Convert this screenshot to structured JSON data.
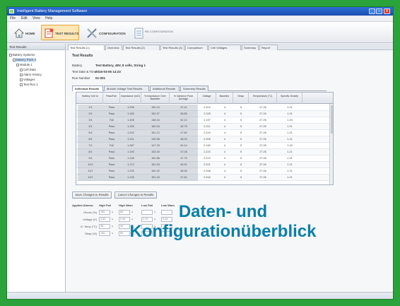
{
  "window": {
    "title": "Intelligent Battery Management Software",
    "controls": {
      "minimize": "_",
      "maximize": "□",
      "close": "X"
    }
  },
  "menu": [
    "File",
    "Edit",
    "View",
    "Help"
  ],
  "ribbon": {
    "home_label": "HOME",
    "test_results_label": "TEST RESULTS",
    "configuration_label": "CONFIGURATION",
    "reconfiguration_label": "RE-CONFIGURATION"
  },
  "sidebar": {
    "header": "Test Results",
    "tree": [
      "Battery Systems",
      "Battery Pack A",
      "Module 1",
      "Cell Data",
      "Alarm History",
      "Voltages",
      "Test Run 1"
    ]
  },
  "tabs": [
    "Test Results (1)",
    "Overview",
    "Test Results (2)",
    "Test Results (3)",
    "Comparison",
    "Cell Voltages",
    "Summary",
    "Report"
  ],
  "section": {
    "title": "Test Results",
    "rows": [
      {
        "label": "Battery",
        "value": "Test Battery, 48V, 8 cells, String 1"
      },
      {
        "label": "Test Date & Time",
        "value": "2015-03-05 14:23"
      },
      {
        "label": "Run Number",
        "value": "01-001"
      }
    ]
  },
  "subtabs": [
    "Individual Results",
    "Module Voltage Test Results",
    "Additional Results",
    "Summary Results"
  ],
  "table": {
    "headers": [
      "Battery Cell Id",
      "Pass/Fail",
      "Impedance (mΩ)",
      "% Impedance Over Baseline",
      "% Variance From Average",
      "Voltage",
      "Baseline",
      "Strap",
      "Temperature (°C)",
      "Specific Gravity"
    ],
    "rows": [
      [
        "1/1",
        "Pass",
        "1.296",
        "150.10",
        "47.41",
        "2.204",
        "4",
        "5",
        "27.26",
        "1.21"
      ],
      [
        "2/1",
        "Pass",
        "1.183",
        "152.37",
        "36.85",
        "2.228",
        "4",
        "5",
        "27.26",
        "1.21"
      ],
      [
        "3/1",
        "Fail",
        "1.406",
        "148.16",
        "52.10",
        "2.197",
        "4",
        "5",
        "27.26",
        "1.20"
      ],
      [
        "4/1",
        "Pass",
        "1.163",
        "150.04",
        "46.79",
        "2.211",
        "4",
        "5",
        "27.26",
        "1.21"
      ],
      [
        "5/1",
        "Pass",
        "1.202",
        "151.12",
        "47.82",
        "2.219",
        "4",
        "5",
        "27.26",
        "1.21"
      ],
      [
        "6/1",
        "Pass",
        "1.211",
        "149.58",
        "48.03",
        "2.206",
        "4",
        "5",
        "27.26",
        "1.21"
      ],
      [
        "7/1",
        "Fail",
        "1.387",
        "147.25",
        "50.14",
        "2.190",
        "4",
        "5",
        "27.26",
        "1.20"
      ],
      [
        "8/1",
        "Pass",
        "1.190",
        "152.40",
        "47.08",
        "2.224",
        "4",
        "5",
        "27.26",
        "1.21"
      ],
      [
        "9/1",
        "Pass",
        "1.208",
        "150.86",
        "47.75",
        "2.213",
        "4",
        "5",
        "27.26",
        "1.21"
      ],
      [
        "10/1",
        "Pass",
        "1.174",
        "151.93",
        "46.91",
        "2.221",
        "4",
        "5",
        "27.26",
        "1.21"
      ],
      [
        "11/1",
        "Pass",
        "1.225",
        "150.32",
        "48.30",
        "2.208",
        "4",
        "5",
        "27.26",
        "1.21"
      ],
      [
        "12/1",
        "Pass",
        "1.199",
        "151.44",
        "47.61",
        "2.216",
        "4",
        "5",
        "27.26",
        "1.21"
      ]
    ]
  },
  "buttons": {
    "save": "Save Changes to Results",
    "cancel": "Cancel Changes to Results"
  },
  "limits": {
    "headers": [
      "Applied Alarms:",
      "High Fail",
      "High Warn",
      "Low Fail",
      "Low Warn"
    ],
    "rows": [
      {
        "label": "Ohmic (%)",
        "f1": "100",
        "f2": "50",
        "f3": "",
        "f4": ""
      },
      {
        "label": "Voltage (V)",
        "f1": "2.30",
        "f2": "2.25",
        "f3": "2.10",
        "f4": "2.15"
      },
      {
        "label": "IC Temp (°C)",
        "f1": "35",
        "f2": "30",
        "f3": "",
        "f4": ""
      },
      {
        "label": "Strap (%)",
        "f1": "100",
        "f2": "50",
        "f3": "",
        "f4": ""
      }
    ]
  },
  "overlay": {
    "line1": "Daten- und",
    "line2": "Konfigurationüberblick"
  },
  "colors": {
    "background": "#2aa33a",
    "overlay_text": "#0a7fa8",
    "active_ribbon": "#fde7b6"
  }
}
